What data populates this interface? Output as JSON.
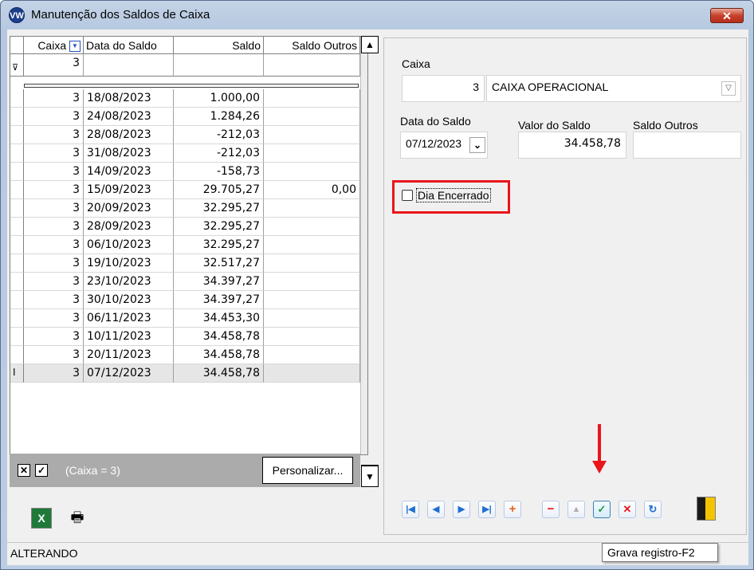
{
  "window": {
    "title": "Manutenção dos Saldos de Caixa",
    "close_glyph": "✕"
  },
  "grid": {
    "columns": [
      "Caixa",
      "Data do Saldo",
      "Saldo",
      "Saldo Outros"
    ],
    "filter_row": {
      "caixa": "3"
    },
    "rows": [
      [
        "3",
        "18/08/2023",
        "1.000,00",
        ""
      ],
      [
        "3",
        "24/08/2023",
        "1.284,26",
        ""
      ],
      [
        "3",
        "28/08/2023",
        "-212,03",
        ""
      ],
      [
        "3",
        "31/08/2023",
        "-212,03",
        ""
      ],
      [
        "3",
        "14/09/2023",
        "-158,73",
        ""
      ],
      [
        "3",
        "15/09/2023",
        "29.705,27",
        "0,00"
      ],
      [
        "3",
        "20/09/2023",
        "32.295,27",
        ""
      ],
      [
        "3",
        "28/09/2023",
        "32.295,27",
        ""
      ],
      [
        "3",
        "06/10/2023",
        "32.295,27",
        ""
      ],
      [
        "3",
        "19/10/2023",
        "32.517,27",
        ""
      ],
      [
        "3",
        "23/10/2023",
        "34.397,27",
        ""
      ],
      [
        "3",
        "30/10/2023",
        "34.397,27",
        ""
      ],
      [
        "3",
        "06/11/2023",
        "34.453,30",
        ""
      ],
      [
        "3",
        "10/11/2023",
        "34.458,78",
        ""
      ],
      [
        "3",
        "20/11/2023",
        "34.458,78",
        ""
      ],
      [
        "3",
        "07/12/2023",
        "34.458,78",
        ""
      ]
    ],
    "selected_row_index": 15
  },
  "filter_bar": {
    "text": "(Caixa = 3)",
    "customize_label": "Personalizar..."
  },
  "form": {
    "caixa_label": "Caixa",
    "caixa_value": "3",
    "caixa_name": "CAIXA OPERACIONAL",
    "data_label": "Data do Saldo",
    "data_value": "07/12/2023",
    "valor_label": "Valor do Saldo",
    "valor_value": "34.458,78",
    "outros_label": "Saldo Outros",
    "outros_value": "",
    "dia_encerrado_label": "Dia Encerrado",
    "dia_encerrado_checked": false
  },
  "status": {
    "text": "ALTERANDO"
  },
  "tooltip": {
    "text": "Grava registro-F2"
  },
  "icons": {
    "app": "vw-logo-icon",
    "excel": "excel-icon",
    "print": "printer-icon",
    "nav": [
      "first-record-icon",
      "prev-record-icon",
      "next-record-icon",
      "last-record-icon",
      "add-icon",
      "remove-icon",
      "edit-icon",
      "confirm-icon",
      "cancel-icon",
      "refresh-icon",
      "exit-icon"
    ]
  },
  "colors": {
    "highlight": "#e8151b",
    "filter_bar": "#ababab"
  }
}
